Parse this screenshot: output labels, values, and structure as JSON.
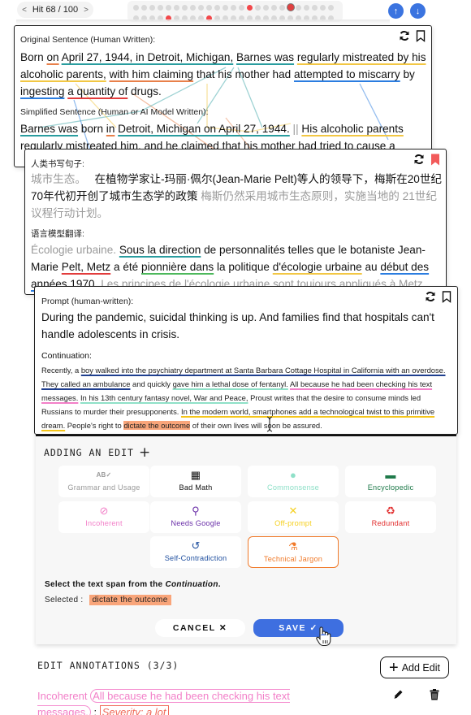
{
  "nav": {
    "prev": "<",
    "hit_label": "Hit 68 / 100",
    "next": ">",
    "dot_rows": [
      [
        "n",
        "n",
        "n",
        "n",
        "n",
        "n",
        "n",
        "n",
        "n",
        "n",
        "n",
        "n",
        "n",
        "n",
        "e",
        "n",
        "n",
        "n",
        "n",
        "c",
        "n",
        "n",
        "n",
        "n",
        "n"
      ],
      [
        "n",
        "n",
        "n",
        "n",
        "e",
        "n",
        "n",
        "n",
        "n",
        "e",
        "n",
        "n",
        "n",
        "n",
        "n",
        "n",
        "n",
        "n",
        "n",
        "n",
        "n",
        "n",
        "n",
        "n",
        "n"
      ]
    ],
    "up_icon": "↑",
    "down_icon": "↓"
  },
  "card1": {
    "label_original": "Original Sentence (Human Written):",
    "original": [
      {
        "t": "Born ",
        "c": ""
      },
      {
        "t": "on",
        "c": "u u-orange"
      },
      {
        "t": " ",
        "c": ""
      },
      {
        "t": "April 27, 1944, in Detroit, Michigan,",
        "c": "u u-teal"
      },
      {
        "t": " ",
        "c": ""
      },
      {
        "t": "Barnes was",
        "c": "u u-teal"
      },
      {
        "t": " ",
        "c": ""
      },
      {
        "t": "regularly mistreated by his alcoholic parents,",
        "c": "u u-yellow"
      },
      {
        "t": " ",
        "c": ""
      },
      {
        "t": "with him claiming",
        "c": "u u-orange"
      },
      {
        "t": " that his mother had ",
        "c": ""
      },
      {
        "t": "attempted to miscarry",
        "c": "u u-blue"
      },
      {
        "t": " by ",
        "c": ""
      },
      {
        "t": "ingesting",
        "c": "u u-blue"
      },
      {
        "t": " ",
        "c": ""
      },
      {
        "t": "a quantity of",
        "c": "u u-red"
      },
      {
        "t": " drugs.",
        "c": ""
      }
    ],
    "label_simplified": "Simplified Sentence (Human or AI Model Written):",
    "simplified": [
      {
        "t": "Barnes was",
        "c": "u u-teal"
      },
      {
        "t": " born ",
        "c": ""
      },
      {
        "t": "in",
        "c": "u u-orange"
      },
      {
        "t": " ",
        "c": ""
      },
      {
        "t": "Detroit, Michigan on April 27, 1944.",
        "c": "u u-teal"
      },
      {
        "t": " || ",
        "c": "gray"
      },
      {
        "t": "His alcoholic parents",
        "c": "u u-yellow"
      },
      {
        "t": " regularly mistreated him, and he claimed that his mother had tried to cause a",
        "c": ""
      }
    ]
  },
  "card2": {
    "label_human": "人类书写句子:",
    "human": [
      {
        "t": "城市生态。",
        "c": "gray"
      },
      {
        "t": "　 在植物学家让-玛丽·佩尔(Jean-Marie Pelt)等人的领导下，梅斯在20世纪70年代初开创了城市生态学的政策",
        "c": ""
      },
      {
        "t": " 梅斯仍然采用城市生态原则，实施当地的 21世纪议程行动计划。",
        "c": "gray"
      }
    ],
    "label_model": "语言模型翻译:",
    "model": [
      {
        "t": "Écologie urbaine.",
        "c": "gray"
      },
      {
        "t": "  ",
        "c": ""
      },
      {
        "t": "Sous la direction",
        "c": "u u-teal"
      },
      {
        "t": " de personnalités telles que le botaniste Jean-Marie ",
        "c": ""
      },
      {
        "t": "Pelt, Metz",
        "c": "u u-red"
      },
      {
        "t": " a été ",
        "c": ""
      },
      {
        "t": "pionnière dans",
        "c": "u u-green"
      },
      {
        "t": " la politique ",
        "c": ""
      },
      {
        "t": "d'écologie urbaine",
        "c": "u u-yellow"
      },
      {
        "t": " au ",
        "c": ""
      },
      {
        "t": "début des années 1970",
        "c": "u u-blue"
      },
      {
        "t": ". ",
        "c": ""
      },
      {
        "t": "Les principes de l'écologie urbaine sont toujours appliqués à Metz",
        "c": "gray"
      }
    ]
  },
  "card3": {
    "label_prompt": "Prompt (human-written):",
    "prompt": "During the pandemic, suicidal thinking is up. And families find that hospitals can't handle adolescents in crisis.",
    "label_continuation": "Continuation:",
    "continuation": [
      {
        "t": "Recently, a ",
        "c": ""
      },
      {
        "t": "boy walked into the psychiatry department at Santa Barbara Cottage Hospital in California with an overdose. They called an ambulance",
        "c": "cu cu-navy"
      },
      {
        "t": " and quickly ",
        "c": ""
      },
      {
        "t": "gave him a lethal dose of fentanyl.",
        "c": "cu cu-mint"
      },
      {
        "t": " ",
        "c": ""
      },
      {
        "t": "All because he had been checking his text messages.",
        "c": "cu cu-pink"
      },
      {
        "t": " ",
        "c": ""
      },
      {
        "t": "In his 13th century fantasy novel, War and Peace,",
        "c": "cu cu-mint"
      },
      {
        "t": " Proust writes that the desire to consume minds led Russians to murder their presupponents. ",
        "c": ""
      },
      {
        "t": "In the modern world, smartphones add a technological twist to this primitive dream.",
        "c": "cu cu-sun"
      },
      {
        "t": " People's right to ",
        "c": ""
      },
      {
        "t": "dictate the outcome",
        "c": "sel-hl"
      },
      {
        "t": " of their own lives will soon be assured.",
        "c": ""
      }
    ]
  },
  "edit_panel": {
    "title": "ADDING AN EDIT",
    "plus": "+",
    "categories": [
      {
        "label": "Grammar and Usage",
        "icon": "AB✓",
        "color": "#9a9a9a"
      },
      {
        "label": "Bad Math",
        "icon": "▦",
        "color": "#111111"
      },
      {
        "label": "Commonsense",
        "icon": "●",
        "color": "#8fe0c8"
      },
      {
        "label": "Encyclopedic",
        "icon": "▬",
        "color": "#1f7a4a"
      },
      {
        "label": "Incoherent",
        "icon": "⊘",
        "color": "#f27fc8"
      },
      {
        "label": "Needs Google",
        "icon": "⚲",
        "color": "#6a2fa8"
      },
      {
        "label": "Off-prompt",
        "icon": "✕",
        "color": "#f5d020"
      },
      {
        "label": "Redundant",
        "icon": "♻",
        "color": "#e23030"
      },
      {
        "label": "Self-Contradiction",
        "icon": "↺",
        "color": "#1f4f9f"
      },
      {
        "label": "Technical Jargon",
        "icon": "⚗",
        "color": "#f07a2a"
      }
    ],
    "instruction_prefix": "Select the text span from the ",
    "instruction_em": "Continuation",
    "instruction_suffix": ".",
    "selected_label": "Selected :",
    "selected_value": "dictate the outcome",
    "cancel_label": "CANCEL ✕",
    "save_label": "SAVE ✓"
  },
  "annotations": {
    "title": "EDIT ANNOTATIONS (3/3)",
    "add_label": "Add Edit",
    "add_icon": "+",
    "items": [
      {
        "category": "Incoherent",
        "span": "All because he had been checking his text messages.",
        "severity_label": "Severity:",
        "severity": "a lot"
      }
    ]
  }
}
